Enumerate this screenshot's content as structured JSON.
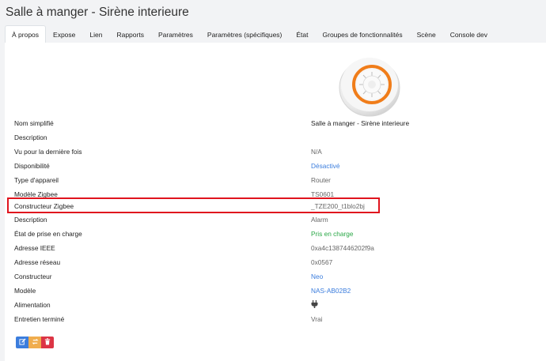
{
  "page": {
    "title": "Salle à manger - Sirène interieure"
  },
  "tabs": [
    {
      "label": "À propos"
    },
    {
      "label": "Expose"
    },
    {
      "label": "Lien"
    },
    {
      "label": "Rapports"
    },
    {
      "label": "Paramètres"
    },
    {
      "label": "Paramètres (spécifiques)"
    },
    {
      "label": "État"
    },
    {
      "label": "Groupes de fonctionnalités"
    },
    {
      "label": "Scène"
    },
    {
      "label": "Console dev"
    }
  ],
  "device": {
    "rows": [
      {
        "label": "Nom simplifié",
        "value": "Salle à manger - Sirène interieure"
      },
      {
        "label": "Description",
        "value": ""
      },
      {
        "label": "Vu pour la dernière fois",
        "value": "N/A"
      },
      {
        "label": "Disponibilité",
        "value": "Désactivé"
      },
      {
        "label": "Type d'appareil",
        "value": "Router"
      },
      {
        "label": "Modèle Zigbee",
        "value": "TS0601"
      },
      {
        "label": "Constructeur Zigbee",
        "value": "_TZE200_t1blo2bj"
      },
      {
        "label": "Description",
        "value": "Alarm"
      },
      {
        "label": "État de prise en charge",
        "value": "Pris en charge"
      },
      {
        "label": "Adresse IEEE",
        "value": "0xa4c1387446202f9a"
      },
      {
        "label": "Adresse réseau",
        "value": "0x0567"
      },
      {
        "label": "Constructeur",
        "value": "Neo"
      },
      {
        "label": "Modèle",
        "value": "NAS-AB02B2"
      },
      {
        "label": "Alimentation",
        "value": ""
      },
      {
        "label": "Entretien terminé",
        "value": "Vrai"
      }
    ]
  },
  "icons": {
    "power": "plug-icon",
    "edit": "edit-icon",
    "reconfigure": "refresh-icon",
    "delete": "trash-icon"
  },
  "colors": {
    "link": "#3b7ddd",
    "success": "#28a745",
    "highlight": "#e0141e",
    "edit_button": "#3b7ddd",
    "reconfigure_button": "#f0ad4e",
    "delete_button": "#dc3545"
  }
}
